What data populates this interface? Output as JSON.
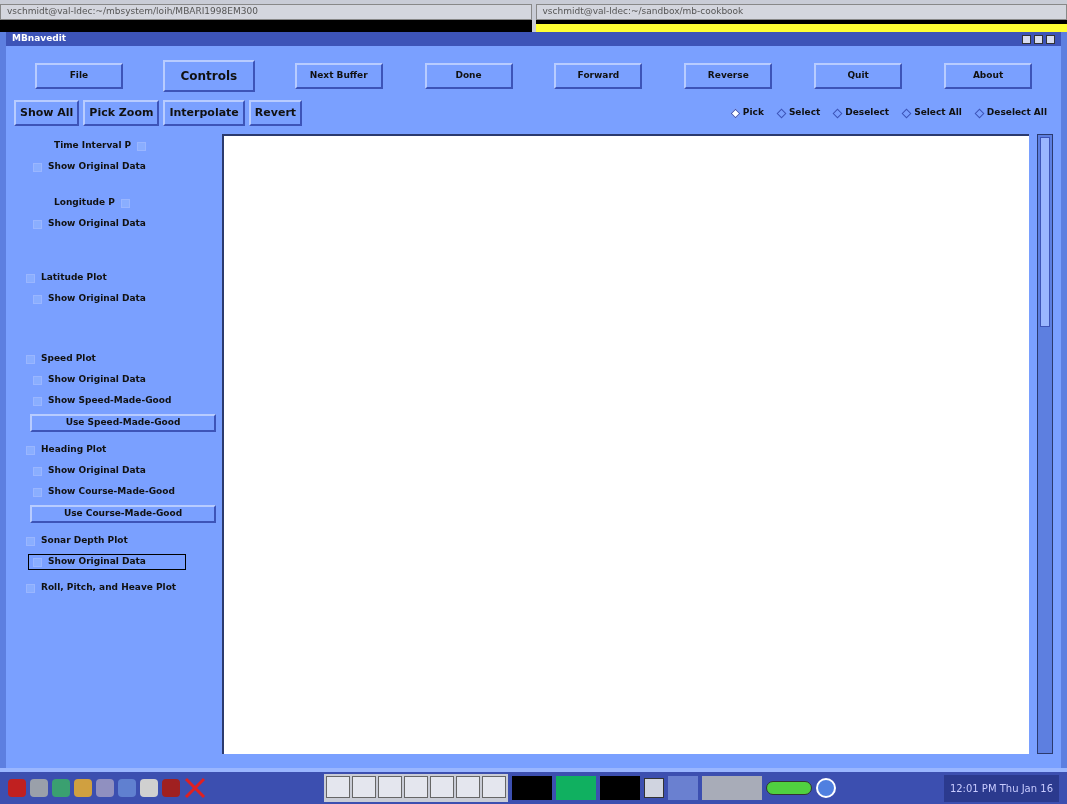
{
  "background_windows": [
    {
      "title": "vschmidt@val-ldec:~/mbsystem/loih/MBARI1998EM300"
    },
    {
      "title": "vschmidt@val-ldec:~/sandbox/mb-cookbook"
    }
  ],
  "window": {
    "title": "MBnavedit"
  },
  "top_buttons": [
    {
      "label": "File",
      "raised": false
    },
    {
      "label": "Controls",
      "raised": true
    },
    {
      "label": "Next Buffer",
      "raised": false
    },
    {
      "label": "Done",
      "raised": false
    },
    {
      "label": "Forward",
      "raised": false
    },
    {
      "label": "Reverse",
      "raised": false
    },
    {
      "label": "Quit",
      "raised": false
    },
    {
      "label": "About",
      "raised": false
    }
  ],
  "tool_buttons": [
    "Show All",
    "Pick Zoom",
    "Interpolate",
    "Revert"
  ],
  "modes": [
    {
      "label": "Pick",
      "selected": true
    },
    {
      "label": "Select",
      "selected": false
    },
    {
      "label": "Deselect",
      "selected": false
    },
    {
      "label": "Select All",
      "selected": false
    },
    {
      "label": "Deselect All",
      "selected": false
    }
  ],
  "plots": [
    {
      "kind": "trailing",
      "label": "Time Interval P",
      "checked": false,
      "children": [
        {
          "kind": "checkbox",
          "label": "Show Original Data",
          "checked": false,
          "focused": false
        }
      ]
    },
    {
      "kind": "trailing",
      "label": "Longitude P",
      "checked": false,
      "children": [
        {
          "kind": "checkbox",
          "label": "Show Original Data",
          "checked": false,
          "focused": false
        }
      ]
    },
    {
      "kind": "checkbox",
      "label": "Latitude Plot",
      "checked": false,
      "children": [
        {
          "kind": "checkbox",
          "label": "Show Original Data",
          "checked": false,
          "focused": false
        }
      ]
    },
    {
      "kind": "checkbox",
      "label": "Speed Plot",
      "checked": false,
      "children": [
        {
          "kind": "checkbox",
          "label": "Show Original Data",
          "checked": false,
          "focused": false
        },
        {
          "kind": "checkbox",
          "label": "Show Speed-Made-Good",
          "checked": false,
          "focused": false
        },
        {
          "kind": "button",
          "label": "Use Speed-Made-Good"
        }
      ]
    },
    {
      "kind": "checkbox",
      "label": "Heading Plot",
      "checked": false,
      "children": [
        {
          "kind": "checkbox",
          "label": "Show Original Data",
          "checked": false,
          "focused": false
        },
        {
          "kind": "checkbox",
          "label": "Show Course-Made-Good",
          "checked": false,
          "focused": false
        },
        {
          "kind": "button",
          "label": "Use Course-Made-Good"
        }
      ]
    },
    {
      "kind": "checkbox",
      "label": "Sonar Depth Plot",
      "checked": false,
      "children": [
        {
          "kind": "checkbox",
          "label": "Show Original Data",
          "checked": false,
          "focused": true
        }
      ]
    },
    {
      "kind": "checkbox",
      "label": "Roll, Pitch, and Heave Plot",
      "checked": false
    }
  ],
  "taskbar": {
    "clock": "12:01 PM Thu Jan 16"
  }
}
